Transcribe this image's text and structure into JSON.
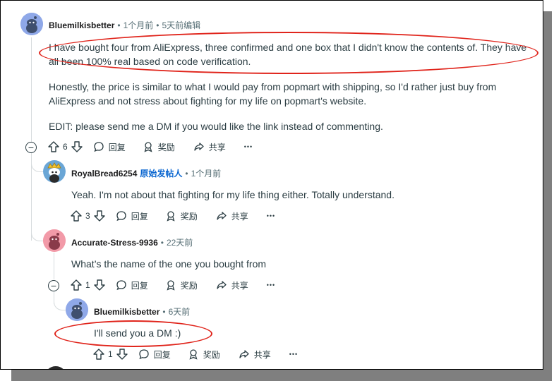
{
  "comments": [
    {
      "username": "Bluemilkisbetter",
      "time": "1个月前",
      "edited": "5天前编辑",
      "lines": [
        "I have bought four from AliExpress, three confirmed and one box that I didn't know the contents of. They have",
        "all been 100% real based on code verification.",
        "Honestly, the price is similar to what I would pay from popmart with shipping, so I'd rather just buy from",
        "AliExpress and not stress about fighting for my life on popmart's website.",
        "EDIT: please send me a DM if you would like the link instead of commenting."
      ],
      "votes": "6"
    },
    {
      "username": "RoyalBread6254",
      "op_badge": "原始发帖人",
      "time": "1个月前",
      "text": "Yeah. I'm not about that fighting for my life thing either. Totally understand.",
      "votes": "3"
    },
    {
      "username": "Accurate-Stress-9936",
      "time": "22天前",
      "text": "What’s the name of the one you bought from",
      "votes": "1"
    },
    {
      "username": "Bluemilkisbetter",
      "time": "6天前",
      "text": "I'll send you a DM :)",
      "votes": "1"
    }
  ],
  "actions": {
    "reply": "回复",
    "award": "奖励",
    "share": "共享",
    "more": "•••"
  },
  "colors": {
    "annotation": "#e0241b",
    "op_badge": "#0a66d0",
    "avatar_blue": "#8fa8e8",
    "avatar_pink": "#f29aa8"
  }
}
